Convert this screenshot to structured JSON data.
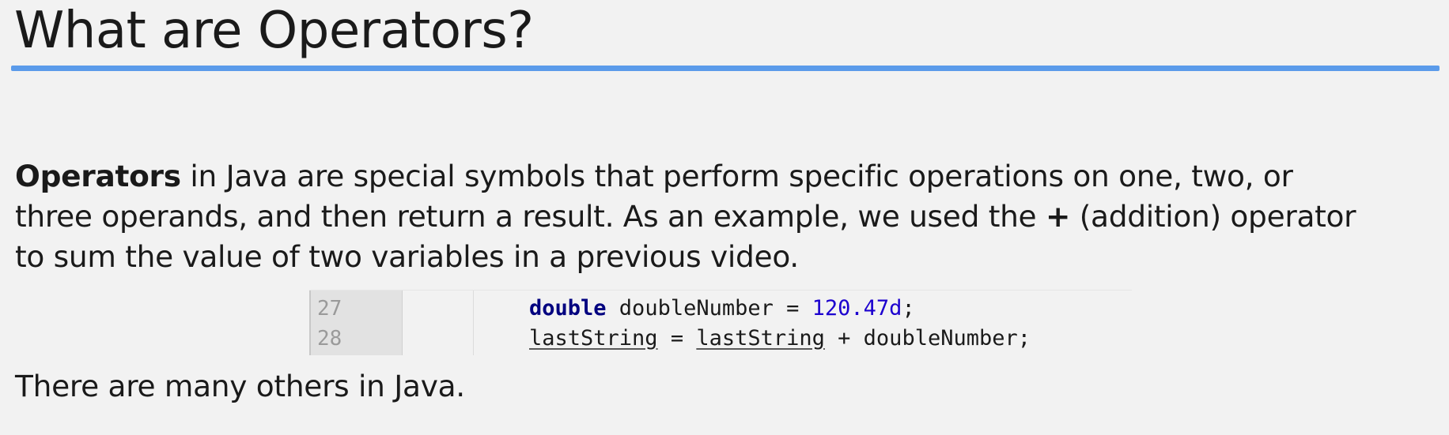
{
  "slide": {
    "title": "What are Operators?",
    "paragraph": {
      "line1_bold": "Operators",
      "line1_rest": " in Java are special symbols that perform specific operations on one, two, or",
      "line2_start": "three operands, and then return a result.  As an example, we used the ",
      "line2_bold": "+",
      "line2_end": " (addition) operator",
      "line3": "to sum the value of two variables in a previous video."
    },
    "code": {
      "lines": [
        {
          "number": "27",
          "keyword": "double",
          "text": " doubleNumber = ",
          "number_literal": "120.47d",
          "end": ";"
        },
        {
          "number": "28",
          "var1": "lastString",
          "mid": " = ",
          "var2": "lastString",
          "end": " + doubleNumber;"
        }
      ]
    },
    "footer": "There are many others in Java."
  },
  "colors": {
    "accent_rule": "#5b9bea",
    "keyword": "#00007f",
    "number_literal": "#1c00cf"
  }
}
